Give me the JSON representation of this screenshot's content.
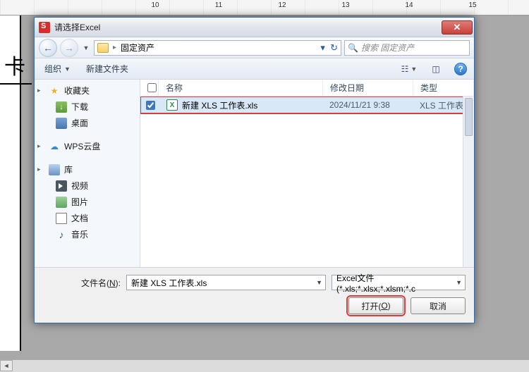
{
  "ruler": {
    "marks": [
      "10",
      "11",
      "12",
      "13",
      "14",
      "15"
    ]
  },
  "bgtext": "卡",
  "dialog": {
    "title": "请选择Excel",
    "address": {
      "folder": "固定资产"
    },
    "search": {
      "placeholder": "搜索 固定资产"
    },
    "toolbar": {
      "organize": "组织",
      "newfolder": "新建文件夹"
    },
    "sidebar": {
      "favorites": {
        "label": "收藏夹",
        "items": [
          {
            "label": "下载",
            "icon": "dl"
          },
          {
            "label": "桌面",
            "icon": "desktop"
          }
        ]
      },
      "wps": {
        "label": "WPS云盘"
      },
      "libraries": {
        "label": "库",
        "items": [
          {
            "label": "视频",
            "icon": "video"
          },
          {
            "label": "图片",
            "icon": "pic"
          },
          {
            "label": "文档",
            "icon": "doc"
          },
          {
            "label": "音乐",
            "icon": "music"
          }
        ]
      }
    },
    "columns": {
      "name": "名称",
      "date": "修改日期",
      "type": "类型"
    },
    "files": [
      {
        "name": "新建 XLS 工作表.xls",
        "date": "2024/11/21 9:38",
        "type": "XLS 工作表",
        "checked": true
      }
    ],
    "footer": {
      "fname_label_pre": "文件名(",
      "fname_label_u": "N",
      "fname_label_post": "):",
      "fname_value": "新建 XLS 工作表.xls",
      "ftype_value": "Excel文件(*.xls;*.xlsx;*.xlsm;*.c",
      "open_pre": "打开(",
      "open_u": "O",
      "open_post": ")",
      "cancel": "取消"
    }
  }
}
